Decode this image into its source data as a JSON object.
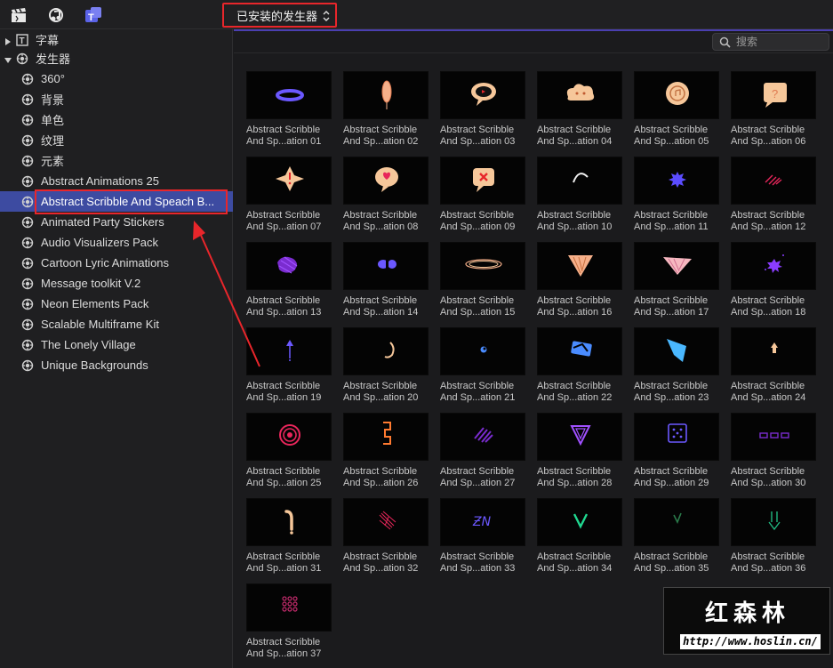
{
  "toolbar": {
    "dropdown_label": "已安装的发生器",
    "icons": [
      "clapper-icon",
      "music-photos-icon",
      "titles-generators-icon"
    ]
  },
  "search": {
    "placeholder": "搜索"
  },
  "sidebar": {
    "items": [
      {
        "label": "字幕",
        "level": 0,
        "expanded": false,
        "selected": false
      },
      {
        "label": "发生器",
        "level": 0,
        "expanded": true,
        "selected": false
      },
      {
        "label": "360°",
        "level": 1,
        "selected": false
      },
      {
        "label": "背景",
        "level": 1,
        "selected": false
      },
      {
        "label": "单色",
        "level": 1,
        "selected": false
      },
      {
        "label": "纹理",
        "level": 1,
        "selected": false
      },
      {
        "label": "元素",
        "level": 1,
        "selected": false
      },
      {
        "label": "Abstract Animations 25",
        "level": 1,
        "selected": false
      },
      {
        "label": "Abstract Scribble And Speach B...",
        "level": 1,
        "selected": true
      },
      {
        "label": "Animated Party Stickers",
        "level": 1,
        "selected": false
      },
      {
        "label": "Audio Visualizers Pack",
        "level": 1,
        "selected": false
      },
      {
        "label": "Cartoon Lyric Animations",
        "level": 1,
        "selected": false
      },
      {
        "label": "Message toolkit V.2",
        "level": 1,
        "selected": false
      },
      {
        "label": "Neon Elements Pack",
        "level": 1,
        "selected": false
      },
      {
        "label": "Scalable Multiframe Kit",
        "level": 1,
        "selected": false
      },
      {
        "label": "The Lonely Village",
        "level": 1,
        "selected": false
      },
      {
        "label": "Unique Backgrounds",
        "level": 1,
        "selected": false
      }
    ]
  },
  "tiles": [
    {
      "line1": "Abstract Scribble",
      "line2": "And Sp...ation 01"
    },
    {
      "line1": "Abstract Scribble",
      "line2": "And Sp...ation 02"
    },
    {
      "line1": "Abstract Scribble",
      "line2": "And Sp...ation 03"
    },
    {
      "line1": "Abstract Scribble",
      "line2": "And Sp...ation 04"
    },
    {
      "line1": "Abstract Scribble",
      "line2": "And Sp...ation 05"
    },
    {
      "line1": "Abstract Scribble",
      "line2": "And Sp...ation 06"
    },
    {
      "line1": "Abstract Scribble",
      "line2": "And Sp...ation 07"
    },
    {
      "line1": "Abstract Scribble",
      "line2": "And Sp...ation 08"
    },
    {
      "line1": "Abstract Scribble",
      "line2": "And Sp...ation 09"
    },
    {
      "line1": "Abstract Scribble",
      "line2": "And Sp...ation 10"
    },
    {
      "line1": "Abstract Scribble",
      "line2": "And Sp...ation 11"
    },
    {
      "line1": "Abstract Scribble",
      "line2": "And Sp...ation 12"
    },
    {
      "line1": "Abstract Scribble",
      "line2": "And Sp...ation 13"
    },
    {
      "line1": "Abstract Scribble",
      "line2": "And Sp...ation 14"
    },
    {
      "line1": "Abstract Scribble",
      "line2": "And Sp...ation 15"
    },
    {
      "line1": "Abstract Scribble",
      "line2": "And Sp...ation 16"
    },
    {
      "line1": "Abstract Scribble",
      "line2": "And Sp...ation 17"
    },
    {
      "line1": "Abstract Scribble",
      "line2": "And Sp...ation 18"
    },
    {
      "line1": "Abstract Scribble",
      "line2": "And Sp...ation 19"
    },
    {
      "line1": "Abstract Scribble",
      "line2": "And Sp...ation 20"
    },
    {
      "line1": "Abstract Scribble",
      "line2": "And Sp...ation 21"
    },
    {
      "line1": "Abstract Scribble",
      "line2": "And Sp...ation 22"
    },
    {
      "line1": "Abstract Scribble",
      "line2": "And Sp...ation 23"
    },
    {
      "line1": "Abstract Scribble",
      "line2": "And Sp...ation 24"
    },
    {
      "line1": "Abstract Scribble",
      "line2": "And Sp...ation 25"
    },
    {
      "line1": "Abstract Scribble",
      "line2": "And Sp...ation 26"
    },
    {
      "line1": "Abstract Scribble",
      "line2": "And Sp...ation 27"
    },
    {
      "line1": "Abstract Scribble",
      "line2": "And Sp...ation 28"
    },
    {
      "line1": "Abstract Scribble",
      "line2": "And Sp...ation 29"
    },
    {
      "line1": "Abstract Scribble",
      "line2": "And Sp...ation 30"
    },
    {
      "line1": "Abstract Scribble",
      "line2": "And Sp...ation 31"
    },
    {
      "line1": "Abstract Scribble",
      "line2": "And Sp...ation 32"
    },
    {
      "line1": "Abstract Scribble",
      "line2": "And Sp...ation 33"
    },
    {
      "line1": "Abstract Scribble",
      "line2": "And Sp...ation 34"
    },
    {
      "line1": "Abstract Scribble",
      "line2": "And Sp...ation 35"
    },
    {
      "line1": "Abstract Scribble",
      "line2": "And Sp...ation 36"
    },
    {
      "line1": "Abstract Scribble",
      "line2": "And Sp...ation 37"
    }
  ],
  "colors": {
    "accent_selection": "#3d4ba1",
    "annotation_red": "#e8262b",
    "thumb_bg": "#040404"
  },
  "watermark": {
    "title": "红森林",
    "url": "http://www.hoslin.cn/"
  }
}
